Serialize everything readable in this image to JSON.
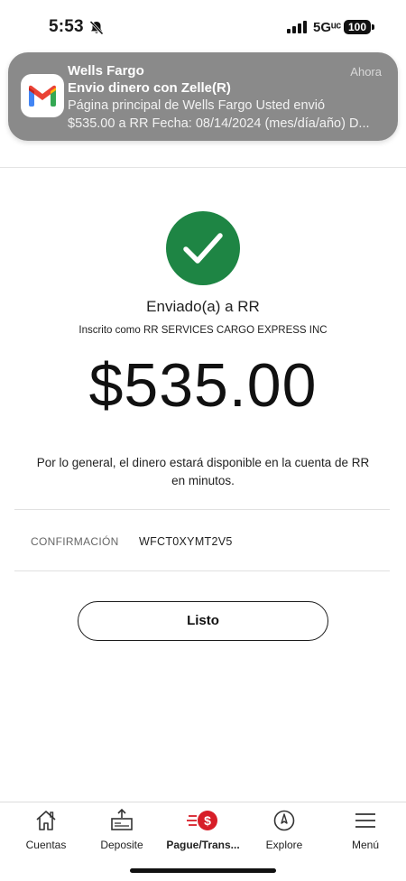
{
  "status_bar": {
    "time": "5:53",
    "network": "5Gᵘᶜ",
    "battery": "100",
    "icons": [
      "bell-slash-icon",
      "signal-bars-icon",
      "battery-icon"
    ]
  },
  "notification": {
    "app": "Wells Fargo",
    "time": "Ahora",
    "title": "Envio dinero con Zelle(R)",
    "body_line1": "Página principal de Wells Fargo Usted envió",
    "body_line2": "$535.00 a RR Fecha: 08/14/2024 (mes/día/año) D...",
    "icon": "gmail-icon"
  },
  "confirmation_screen": {
    "status_icon": "checkmark-icon",
    "status_color": "#1e8544",
    "recipient": "Enviado(a) a RR",
    "enrolled_as": "Inscrito como RR SERVICES CARGO EXPRESS INC",
    "amount": "$535.00",
    "availability_line1": "Por lo general, el dinero estará disponible en la cuenta de RR",
    "availability_line2": "en minutos.",
    "confirmation_label": "CONFIRMACIÓN",
    "confirmation_value": "WFCT0XYMT2V5",
    "done_label": "Listo"
  },
  "tab_bar": {
    "accent_color": "#d71e28",
    "tabs": [
      {
        "label": "Cuentas",
        "icon": "house-icon",
        "active": false
      },
      {
        "label": "Deposite",
        "icon": "check-deposit-icon",
        "active": false
      },
      {
        "label": "Pague/Trans...",
        "icon": "dollar-send-icon",
        "active": true
      },
      {
        "label": "Explore",
        "icon": "compass-icon",
        "active": false
      },
      {
        "label": "Menú",
        "icon": "hamburger-menu-icon",
        "active": false
      }
    ]
  }
}
